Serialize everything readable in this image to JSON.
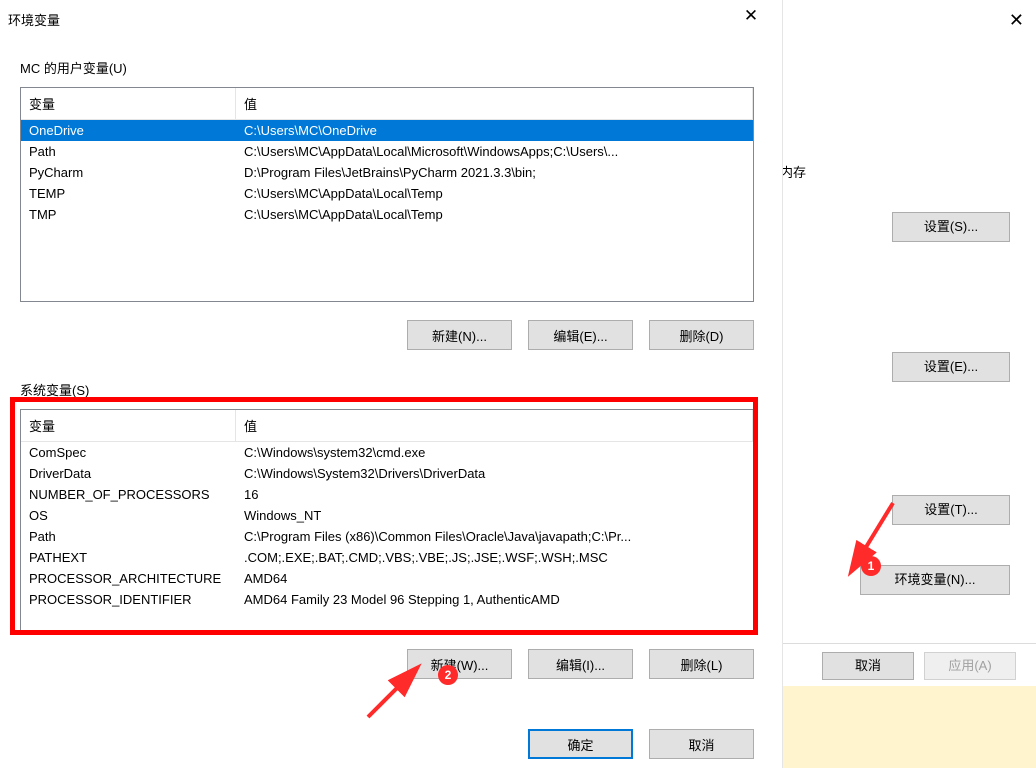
{
  "env_dialog": {
    "title": "环境变量",
    "close_glyph": "✕",
    "user_section_label": "MC 的用户变量(U)",
    "system_section_label": "系统变量(S)",
    "col_variable": "变量",
    "col_value": "值",
    "user_vars": [
      {
        "name": "OneDrive",
        "value": "C:\\Users\\MC\\OneDrive",
        "selected": true
      },
      {
        "name": "Path",
        "value": "C:\\Users\\MC\\AppData\\Local\\Microsoft\\WindowsApps;C:\\Users\\...",
        "selected": false
      },
      {
        "name": "PyCharm",
        "value": "D:\\Program Files\\JetBrains\\PyCharm 2021.3.3\\bin;",
        "selected": false
      },
      {
        "name": "TEMP",
        "value": "C:\\Users\\MC\\AppData\\Local\\Temp",
        "selected": false
      },
      {
        "name": "TMP",
        "value": "C:\\Users\\MC\\AppData\\Local\\Temp",
        "selected": false
      }
    ],
    "system_vars": [
      {
        "name": "ComSpec",
        "value": "C:\\Windows\\system32\\cmd.exe"
      },
      {
        "name": "DriverData",
        "value": "C:\\Windows\\System32\\Drivers\\DriverData"
      },
      {
        "name": "NUMBER_OF_PROCESSORS",
        "value": "16"
      },
      {
        "name": "OS",
        "value": "Windows_NT"
      },
      {
        "name": "Path",
        "value": "C:\\Program Files (x86)\\Common Files\\Oracle\\Java\\javapath;C:\\Pr..."
      },
      {
        "name": "PATHEXT",
        "value": ".COM;.EXE;.BAT;.CMD;.VBS;.VBE;.JS;.JSE;.WSF;.WSH;.MSC"
      },
      {
        "name": "PROCESSOR_ARCHITECTURE",
        "value": "AMD64"
      },
      {
        "name": "PROCESSOR_IDENTIFIER",
        "value": "AMD64 Family 23 Model 96 Stepping 1, AuthenticAMD"
      }
    ],
    "user_buttons": {
      "new": "新建(N)...",
      "edit": "编辑(E)...",
      "delete": "删除(D)"
    },
    "sys_buttons": {
      "new": "新建(W)...",
      "edit": "编辑(I)...",
      "delete": "删除(L)"
    },
    "ok": "确定",
    "cancel": "取消"
  },
  "bg_dialog": {
    "close_glyph": "✕",
    "memory_label": "内存",
    "settings_s": "设置(S)...",
    "settings_e": "设置(E)...",
    "settings_t": "设置(T)...",
    "env_btn": "环境变量(N)...",
    "cancel": "取消",
    "apply": "应用(A)"
  },
  "annotations": {
    "badge1": "1",
    "badge2": "2"
  }
}
